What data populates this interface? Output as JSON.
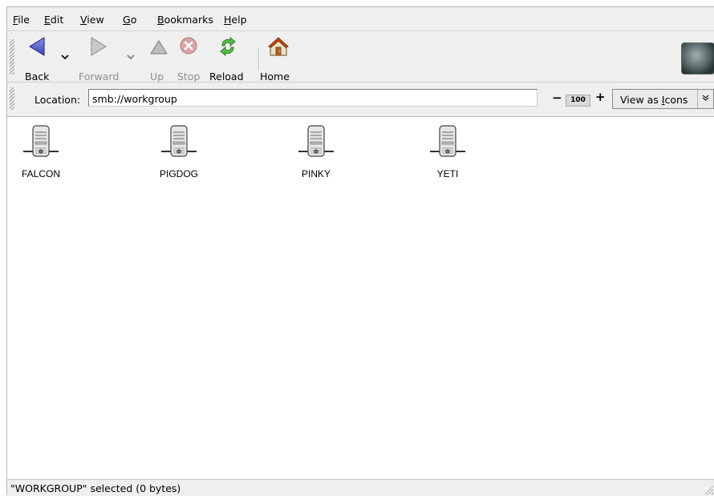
{
  "menubar": {
    "items": [
      {
        "mnemonic": "F",
        "rest": "ile"
      },
      {
        "mnemonic": "E",
        "rest": "dit"
      },
      {
        "mnemonic": "V",
        "rest": "iew"
      },
      {
        "mnemonic": "G",
        "rest": "o"
      },
      {
        "mnemonic": "B",
        "rest": "ookmarks"
      },
      {
        "mnemonic": "H",
        "rest": "elp"
      }
    ]
  },
  "toolbar": {
    "back_label": "Back",
    "forward_label": "Forward",
    "up_label": "Up",
    "stop_label": "Stop",
    "reload_label": "Reload",
    "home_label": "Home"
  },
  "location": {
    "label": "Location:",
    "value": "smb://workgroup"
  },
  "zoom": {
    "minus": "−",
    "value": "100",
    "plus": "+"
  },
  "view_as": {
    "prefix": "View as ",
    "mnemonic": "I",
    "rest": "cons"
  },
  "files": [
    {
      "name": "FALCON",
      "icon": "server-icon"
    },
    {
      "name": "PIGDOG",
      "icon": "server-icon"
    },
    {
      "name": "PINKY",
      "icon": "server-icon"
    },
    {
      "name": "YETI",
      "icon": "server-icon"
    }
  ],
  "status": {
    "text": "\"WORKGROUP\" selected (0 bytes)"
  },
  "colors": {
    "window_bg": "#efefef",
    "content_bg": "#ffffff",
    "back_arrow": "#5460c8",
    "home_roof": "#c84a12"
  }
}
